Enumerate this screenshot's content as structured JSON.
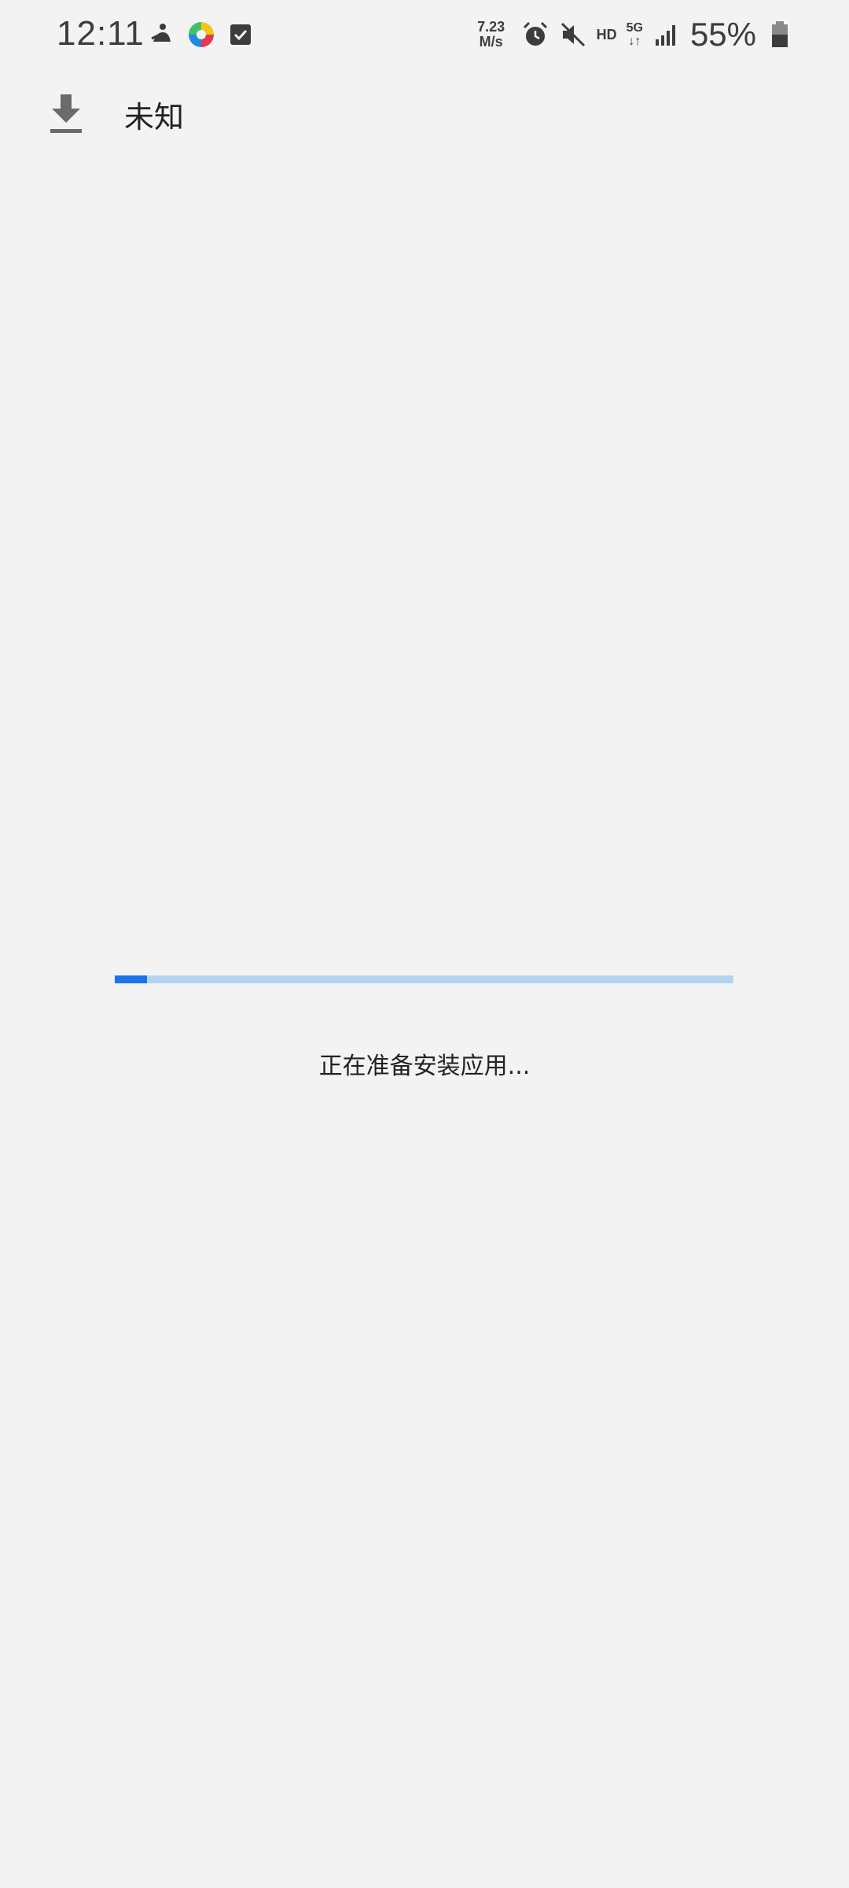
{
  "status_bar": {
    "time": "12:11",
    "left_icons": [
      "kite-icon",
      "multicolor-app-icon",
      "checkbox-icon"
    ],
    "net_speed_value": "7.23",
    "net_speed_unit": "M/s",
    "hd_label": "HD",
    "network_label": "5G",
    "network_arrows": "↓↑",
    "battery_percent": "55%",
    "right_icons": [
      "alarm-icon",
      "mute-icon",
      "signal-icon",
      "battery-icon"
    ]
  },
  "header": {
    "icon": "download-icon",
    "title": "未知"
  },
  "install": {
    "progress": 0.052,
    "status_text": "正在准备安装应用..."
  },
  "colors": {
    "background": "#f3f3f3",
    "progress_fill": "#1a73e8",
    "progress_track": "#b3d4f0",
    "icon_gray": "#6b6b6b"
  }
}
